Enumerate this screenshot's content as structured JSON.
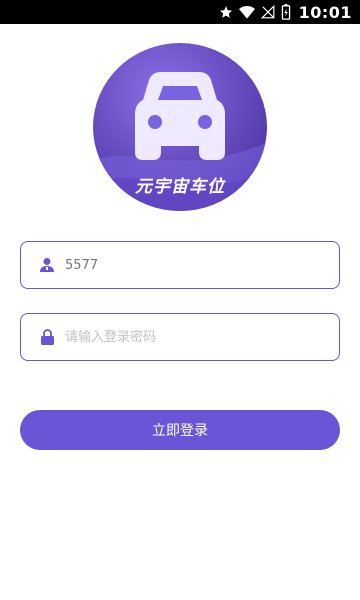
{
  "status_bar": {
    "time": "10:01",
    "icons": [
      "star-icon",
      "wifi-icon",
      "no-signal-icon",
      "battery-charging-icon"
    ]
  },
  "logo": {
    "text": "元宇宙车位",
    "icon": "car-icon"
  },
  "form": {
    "username": {
      "value": "5577",
      "icon": "user-icon"
    },
    "password": {
      "placeholder": "请输入登录密码",
      "value": "",
      "icon": "lock-icon"
    },
    "login_button": "立即登录"
  },
  "colors": {
    "accent": "#6a55d6",
    "logo_dark": "#4a2f9e",
    "logo_light": "#8a6fe8"
  }
}
